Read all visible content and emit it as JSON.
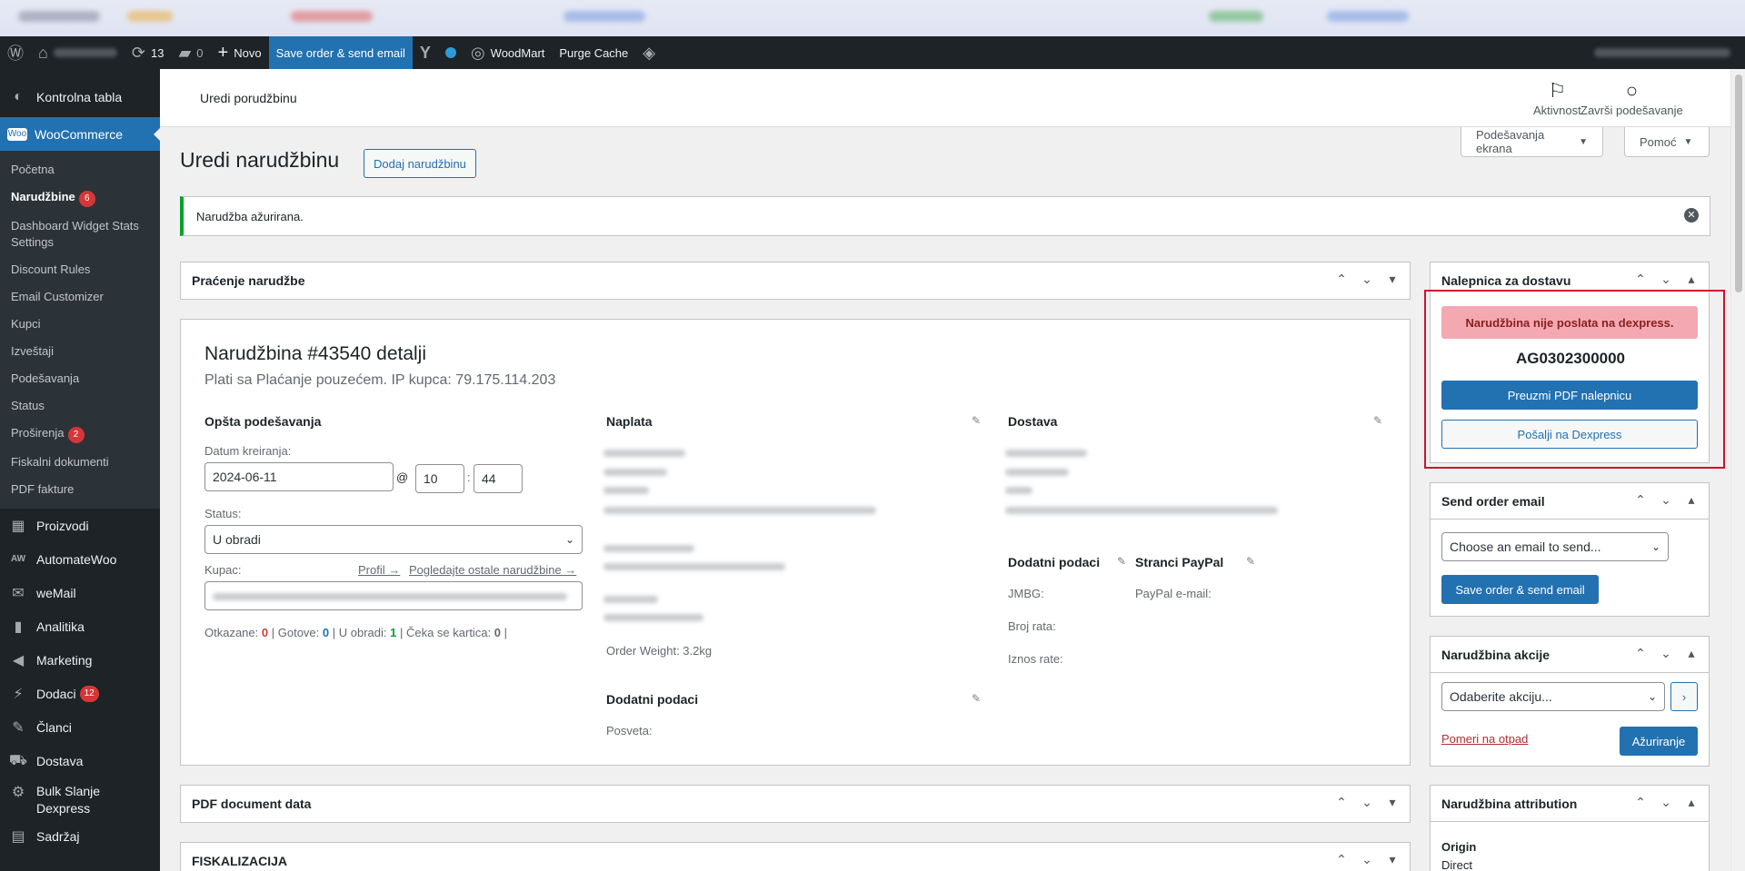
{
  "adminbar": {
    "updates_count": "13",
    "comments_count": "0",
    "new_label": "Novo",
    "save_send_label": "Save order & send email",
    "woodmart_label": "WoodMart",
    "purge_cache_label": "Purge Cache"
  },
  "sidebar": {
    "dashboard": "Kontrolna tabla",
    "woocommerce": "WooCommerce",
    "sub": {
      "pocetna": "Početna",
      "narudzbine": "Narudžbine",
      "narudzbine_badge": "6",
      "dashboard_widget": "Dashboard Widget Stats Settings",
      "discount_rules": "Discount Rules",
      "email_customizer": "Email Customizer",
      "kupci": "Kupci",
      "izvestaji": "Izveštaji",
      "podesavanja": "Podešavanja",
      "status": "Status",
      "prosirenja": "Proširenja",
      "prosirenja_badge": "2",
      "fiskalni": "Fiskalni dokumenti",
      "pdf": "PDF fakture"
    },
    "proizvodi": "Proizvodi",
    "automatewoo": "AutomateWoo",
    "wemail": "weMail",
    "analitika": "Analitika",
    "marketing": "Marketing",
    "dodaci": "Dodaci",
    "dodaci_badge": "12",
    "clanci": "Članci",
    "dostava": "Dostava",
    "bulk": "Bulk Slanje Dexpress",
    "last": "Sadržaj"
  },
  "header": {
    "title": "Uredi porudžbinu",
    "activity": "Aktivnost",
    "finish_setup": "Završi podešavanje",
    "screen_options": "Podešavanja ekrana",
    "help": "Pomoć"
  },
  "page": {
    "title": "Uredi narudžbinu",
    "add_order": "Dodaj narudžbinu",
    "notice": "Narudžba ažurirana."
  },
  "tracking": {
    "title": "Praćenje narudžbe"
  },
  "order": {
    "heading": "Narudžbina #43540 detalji",
    "subheading": "Plati sa Plaćanje pouzećem. IP kupca: 79.175.114.203",
    "general": "Opšta podešavanja",
    "date_label": "Datum kreiranja:",
    "date": "2024-06-11",
    "at": "@",
    "hour": "10",
    "colon": ":",
    "minute": "44",
    "status_label": "Status:",
    "status": "U obradi",
    "customer_label": "Kupac:",
    "profile_link": "Profil →",
    "other_orders_link": "Pogledajte ostale narudžbine →",
    "stats": {
      "otkazane_label": "Otkazane:",
      "otkazane": "0",
      "gotove_label": "Gotove:",
      "gotove": "0",
      "obradi_label": "U obradi:",
      "obradi": "1",
      "kartica_label": "Čeka se kartica:",
      "kartica": "0"
    },
    "billing": "Naplata",
    "order_weight": "Order Weight: 3.2kg",
    "billing_extra": "Dodatni podaci",
    "posveta": "Posveta:",
    "shipping": "Dostava",
    "shipping_extra": "Dodatni podaci",
    "jmbg": "JMBG:",
    "broj_rata": "Broj rata:",
    "iznos_rate": "Iznos rate:",
    "paypal": "Stranci PayPal",
    "paypal_email": "PayPal e-mail:"
  },
  "pdf_box": {
    "title": "PDF document data"
  },
  "fisk_box": {
    "title": "FISKALIZACIJA"
  },
  "label_box": {
    "title": "Nalepnica za dostavu",
    "warning": "Narudžbina nije poslata na dexpress.",
    "code": "AG0302300000",
    "download_btn": "Preuzmi PDF nalepnicu",
    "send_btn": "Pošalji na Dexpress",
    "warning_bg": "#f4a9b2",
    "warning_color": "#8a1f1f"
  },
  "email_box": {
    "title": "Send order email",
    "select": "Choose an email to send...",
    "button": "Save order & send email"
  },
  "actions_box": {
    "title": "Narudžbina akcije",
    "select": "Odaberite akciju...",
    "trash": "Pomeri na otpad",
    "update": "Ažuriranje"
  },
  "attribution_box": {
    "title": "Narudžbina attribution",
    "origin_label": "Origin",
    "origin_value": "Direct"
  }
}
